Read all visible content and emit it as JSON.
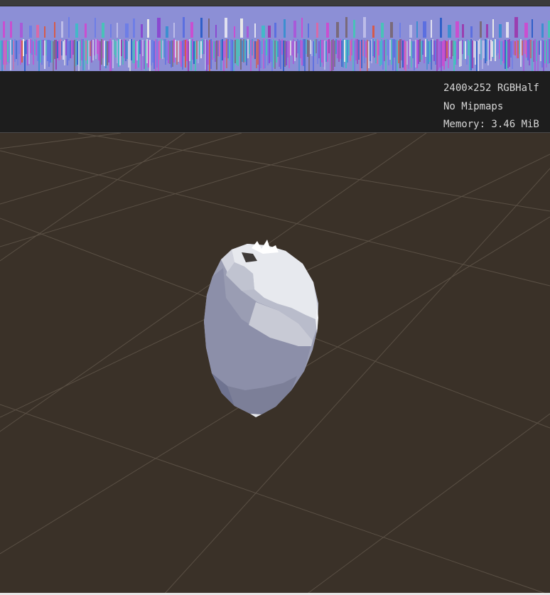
{
  "texture_info": {
    "dimensions_format": "2400×252 RGBHalf",
    "mipmaps": "No Mipmaps",
    "memory": "Memory: 3.46 MiB"
  },
  "colors": {
    "strip_background": "#8c8fd6",
    "panel_background": "#1d1d1d",
    "panel_text": "#d6d6d6",
    "scene_background": "#3a3128",
    "grid_line": "#5a5045",
    "mesh_light": "#e7e9ee",
    "mesh_mid": "#b9bccb",
    "mesh_dark": "#7f829d"
  },
  "icons": {
    "texture_preview": "vertex-texture-preview",
    "scene_object": "egg-shaped-mesh"
  }
}
